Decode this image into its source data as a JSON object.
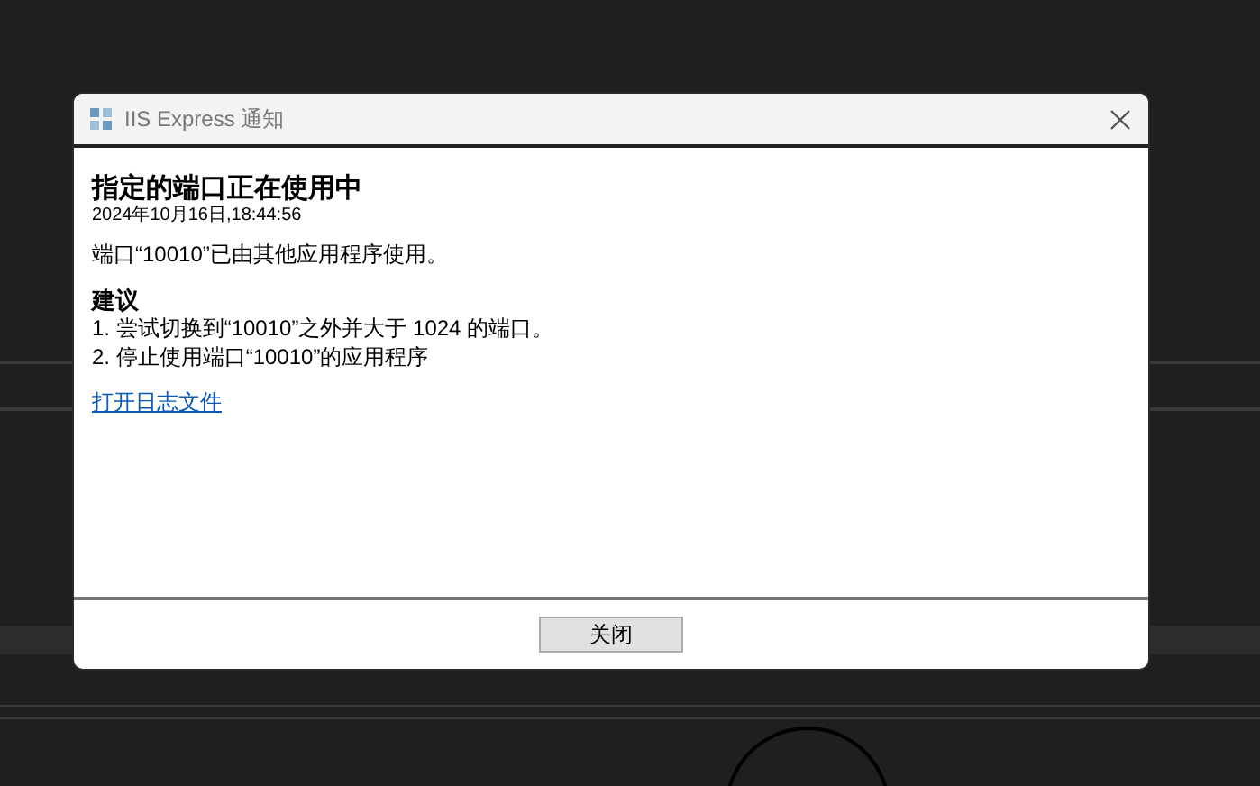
{
  "window": {
    "title": "IIS Express 通知"
  },
  "heading": "指定的端口正在使用中",
  "timestamp": "2024年10月16日,18:44:56",
  "message": "端口“10010”已由其他应用程序使用。",
  "suggestions": {
    "title": "建议",
    "items": [
      "1. 尝试切换到“10010”之外并大于 1024 的端口。",
      "2. 停止使用端口“10010”的应用程序"
    ]
  },
  "link": "打开日志文件",
  "buttons": [
    "关闭"
  ]
}
